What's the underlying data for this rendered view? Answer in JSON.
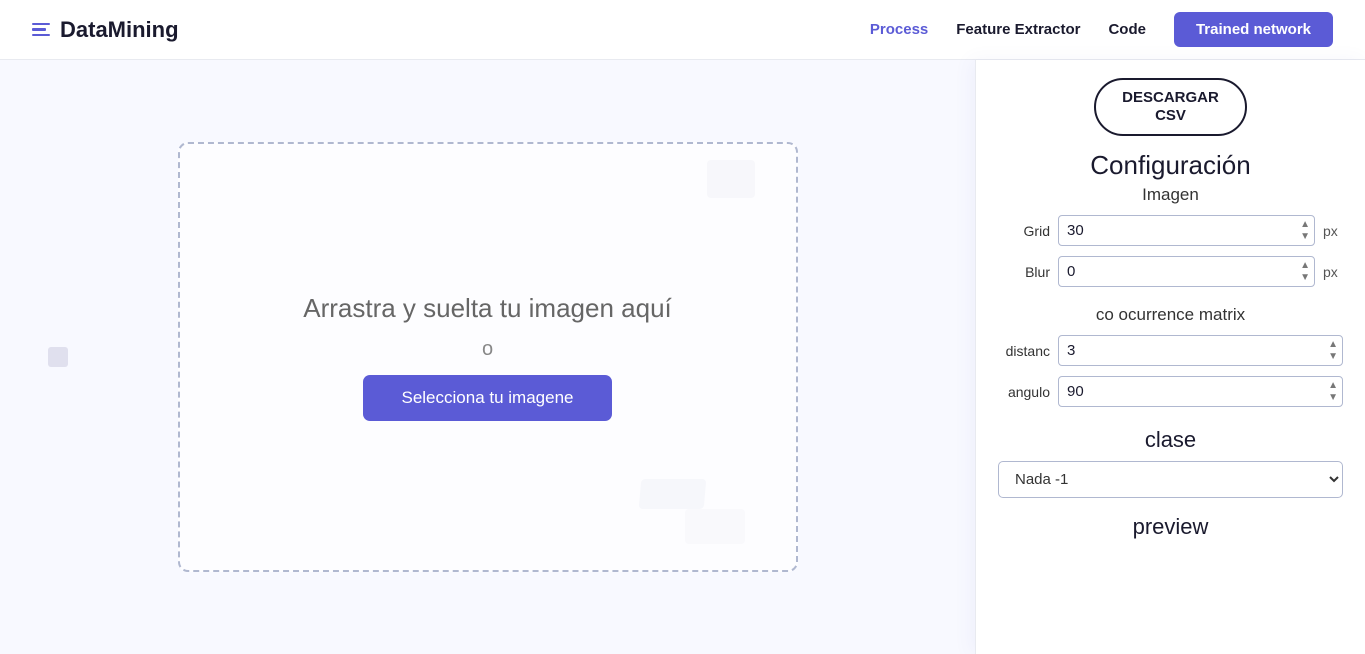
{
  "header": {
    "logo_text": "DataMining",
    "nav": {
      "process": "Process",
      "feature_extractor": "Feature Extractor",
      "code": "Code",
      "trained_network": "Trained network"
    }
  },
  "dropzone": {
    "main_text": "Arrastra y suelta tu imagen aquí",
    "or_text": "o",
    "button_label": "Selecciona tu imagene"
  },
  "sidebar": {
    "descargar_label": "DESCARGAR\nCSV",
    "config_title": "Configuración",
    "imagen_label": "Imagen",
    "grid_label": "Grid",
    "grid_value": "30",
    "grid_unit": "px",
    "blur_label": "Blur",
    "blur_value": "0",
    "blur_unit": "px",
    "matrix_title": "co ocurrence matrix",
    "distance_label": "distanc",
    "distance_value": "3",
    "angle_label": "angulo",
    "angle_value": "90",
    "clase_title": "clase",
    "clase_options": [
      "Nada -1"
    ],
    "clase_selected": "Nada -1",
    "preview_title": "preview"
  }
}
